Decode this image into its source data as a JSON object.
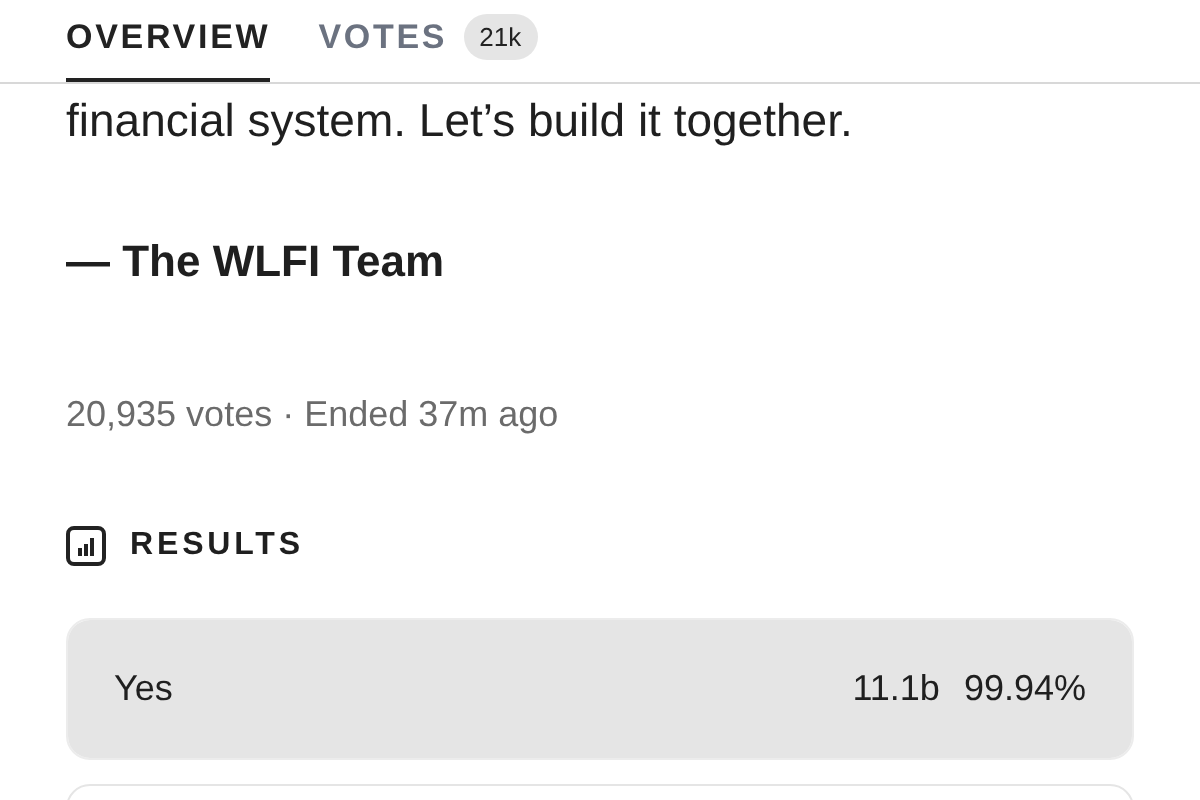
{
  "tabs": [
    {
      "label": "OVERVIEW",
      "selected": true
    },
    {
      "label": "VOTES",
      "selected": false,
      "badge": "21k"
    }
  ],
  "body": {
    "text": "financial system. Let’s build it together.",
    "signature": "— The WLFI Team"
  },
  "meta": "20,935 votes · Ended 37m ago",
  "results": {
    "title": "RESULTS",
    "options": [
      {
        "label": "Yes",
        "amount": "11.1b",
        "percent": "99.94%",
        "level": 0.9994
      }
    ]
  }
}
